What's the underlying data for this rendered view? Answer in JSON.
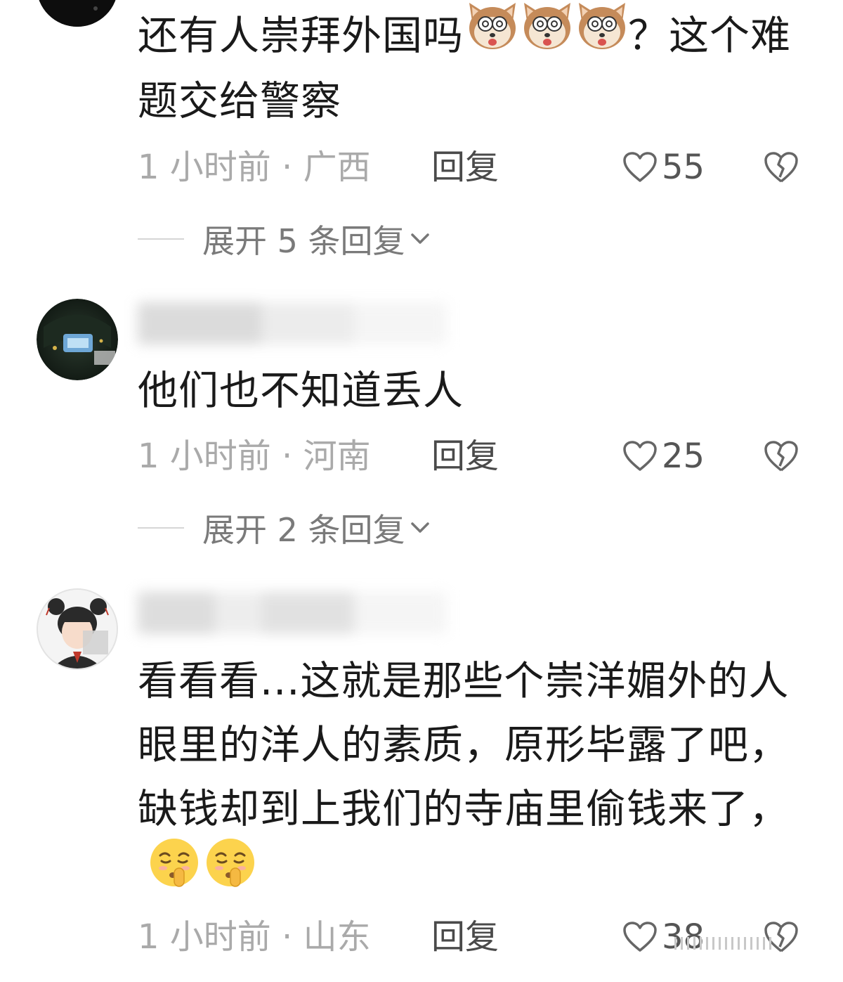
{
  "comments": [
    {
      "username": "",
      "text": "还有人崇拜外国吗",
      "text_after_emoji": "？这个难题交给警察",
      "emojis": [
        "dog-face-emoji",
        "dog-face-emoji",
        "dog-face-emoji"
      ],
      "time_loc": "1 小时前 · 广西",
      "reply_label": "回复",
      "likes": "55",
      "expand_label": "展开 5 条回复"
    },
    {
      "username": "",
      "text": "他们也不知道丢人",
      "time_loc": "1 小时前 · 河南",
      "reply_label": "回复",
      "likes": "25",
      "expand_label": "展开 2 条回复"
    },
    {
      "username": "",
      "text": "看看看...这就是那些个崇洋媚外的人眼里的洋人的素质，原形毕露了吧，缺钱却到上我们的寺庙里偷钱来了，",
      "emojis": [
        "shush-face-emoji",
        "shush-face-emoji"
      ],
      "time_loc": "1 小时前 · 山东",
      "reply_label": "回复",
      "likes": "38"
    }
  ],
  "icons": {
    "like": "heart-outline-icon",
    "dislike": "broken-heart-icon",
    "expand": "chevron-down-icon"
  },
  "colors": {
    "text": "#1a1a1a",
    "meta": "#aaaaaa",
    "reply": "#4a4a4a"
  }
}
